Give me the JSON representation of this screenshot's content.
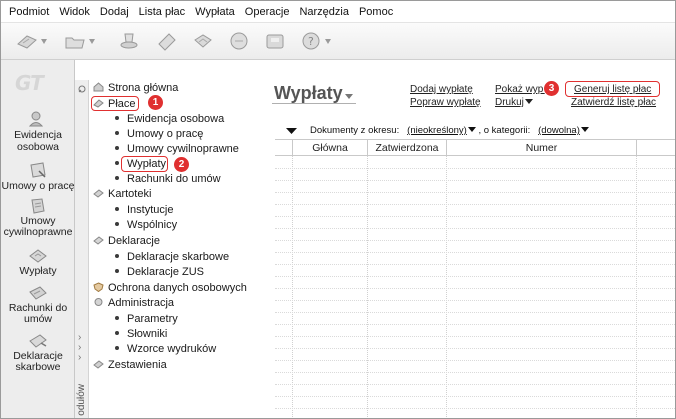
{
  "menu": [
    "Podmiot",
    "Widok",
    "Dodaj",
    "Lista płac",
    "Wypłata",
    "Operacje",
    "Narzędzia",
    "Pomoc"
  ],
  "logo": "GT",
  "left_nav": [
    {
      "label": "Ewidencja osobowa",
      "icon": "personnel-icon"
    },
    {
      "label": "Umowy o pracę",
      "icon": "contract-icon"
    },
    {
      "label": "Umowy cywilnoprawne",
      "icon": "civil-contract-icon"
    },
    {
      "label": "Wypłaty",
      "icon": "payments-icon"
    },
    {
      "label": "Rachunki do umów",
      "icon": "invoice-icon"
    },
    {
      "label": "Deklaracje skarbowe",
      "icon": "tax-declaration-icon"
    }
  ],
  "tree": {
    "home": "Strona główna",
    "place": "Płace",
    "place_items": [
      "Ewidencja osobowa",
      "Umowy o pracę",
      "Umowy cywilnoprawne",
      "Wypłaty",
      "Rachunki do umów"
    ],
    "kartoteki": "Kartoteki",
    "kartoteki_items": [
      "Instytucje",
      "Wspólnicy"
    ],
    "deklaracje": "Deklaracje",
    "deklaracje_items": [
      "Deklaracje skarbowe",
      "Deklaracje ZUS"
    ],
    "ochrona": "Ochrona danych osobowych",
    "administracja": "Administracja",
    "administracja_items": [
      "Parametry",
      "Słowniki",
      "Wzorce wydruków"
    ],
    "zestawienia": "Zestawienia"
  },
  "splitter_label": "odułów",
  "badges": [
    "1",
    "2",
    "3"
  ],
  "page": {
    "title": "Wypłaty",
    "actions": {
      "add": "Dodaj wypłatę",
      "fix": "Popraw wypłatę",
      "show": "Pokaż wypł",
      "print": "Drukuj",
      "generate": "Generuj listę płac",
      "approve": "Zatwierdź listę płac"
    },
    "filter": {
      "label": "Dokumenty z okresu:",
      "period": "(nieokreślony)",
      "sep": ", o kategorii:",
      "category": "(dowolna)"
    }
  },
  "grid": {
    "columns": [
      "",
      "Główna",
      "Zatwierdzona",
      "Numer",
      ""
    ]
  },
  "colors": {
    "highlight": "#e03030",
    "panel_bg": "#ededed"
  }
}
